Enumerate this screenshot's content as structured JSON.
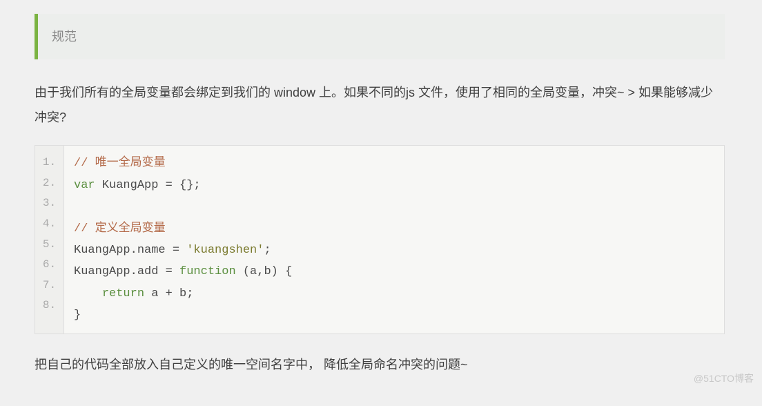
{
  "blockquote": {
    "text": "规范"
  },
  "paragraph1": "由于我们所有的全局变量都会绑定到我们的 window 上。如果不同的js 文件，使用了相同的全局变量，冲突~ > 如果能够减少冲突?",
  "code": {
    "lineNumbers": [
      "1.",
      "2.",
      "3.",
      "4.",
      "5.",
      "6.",
      "7.",
      "8."
    ],
    "line1_comment": "// 唯一全局变量",
    "line2_kw": "var",
    "line2_rest": " KuangApp = {};",
    "line4_comment": "// 定义全局变量",
    "line5": "KuangApp.name = ",
    "line5_str": "'kuangshen'",
    "line5_end": ";",
    "line6_a": "KuangApp.add = ",
    "line6_kw": "function",
    "line6_b": " (a,b) {",
    "line7_indent": "    ",
    "line7_kw": "return",
    "line7_rest": " a + b;",
    "line8": "}"
  },
  "paragraph2": "把自己的代码全部放入自己定义的唯一空间名字中， 降低全局命名冲突的问题~",
  "watermark": "@51CTO博客"
}
